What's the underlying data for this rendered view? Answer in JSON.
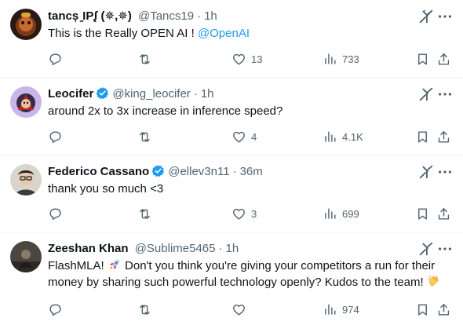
{
  "tweets": [
    {
      "display_name": "tancșˏ͙IPᶘ (✵,✵)",
      "handle": "@Tancs19",
      "separator": "·",
      "time": "1h",
      "text": "This is the Really OPEN AI ! ",
      "mention": "@OpenAI",
      "replies": "",
      "reposts": "",
      "likes": "13",
      "views": "733",
      "verified": false
    },
    {
      "display_name": "Leocifer",
      "handle": "@king_leocifer",
      "separator": "·",
      "time": "1h",
      "text": "around 2x to 3x increase in inference speed?",
      "replies": "",
      "reposts": "",
      "likes": "4",
      "views": "4.1K",
      "verified": true
    },
    {
      "display_name": "Federico Cassano",
      "handle": "@ellev3n11",
      "separator": "·",
      "time": "36m",
      "text": "thank you so much <3",
      "replies": "",
      "reposts": "",
      "likes": "3",
      "views": "699",
      "verified": true
    },
    {
      "display_name": "Zeeshan Khan",
      "handle": "@Sublime5465",
      "separator": "·",
      "time": "1h",
      "text_line1_a": "FlashMLA! ",
      "text_line1_b": " Don't you think you're giving your competitors a run for their",
      "text_line2": "money by sharing such powerful technology openly? Kudos to the team! ",
      "replies": "",
      "reposts": "",
      "likes": "",
      "views": "974",
      "verified": false
    }
  ],
  "icons": {
    "reply": "reply-icon",
    "repost": "repost-icon",
    "like": "heart-icon",
    "views": "views-icon",
    "bookmark": "bookmark-icon",
    "share": "share-icon",
    "grok": "grok-icon",
    "more": "more-icon",
    "verified": "verified-badge-icon",
    "rocket": "rocket-emoji-icon",
    "clap": "clapping-hands-emoji-icon"
  },
  "colors": {
    "text": "#0f1419",
    "secondary": "#536471",
    "accent": "#1d9bf0",
    "divider": "#eff3f4"
  }
}
